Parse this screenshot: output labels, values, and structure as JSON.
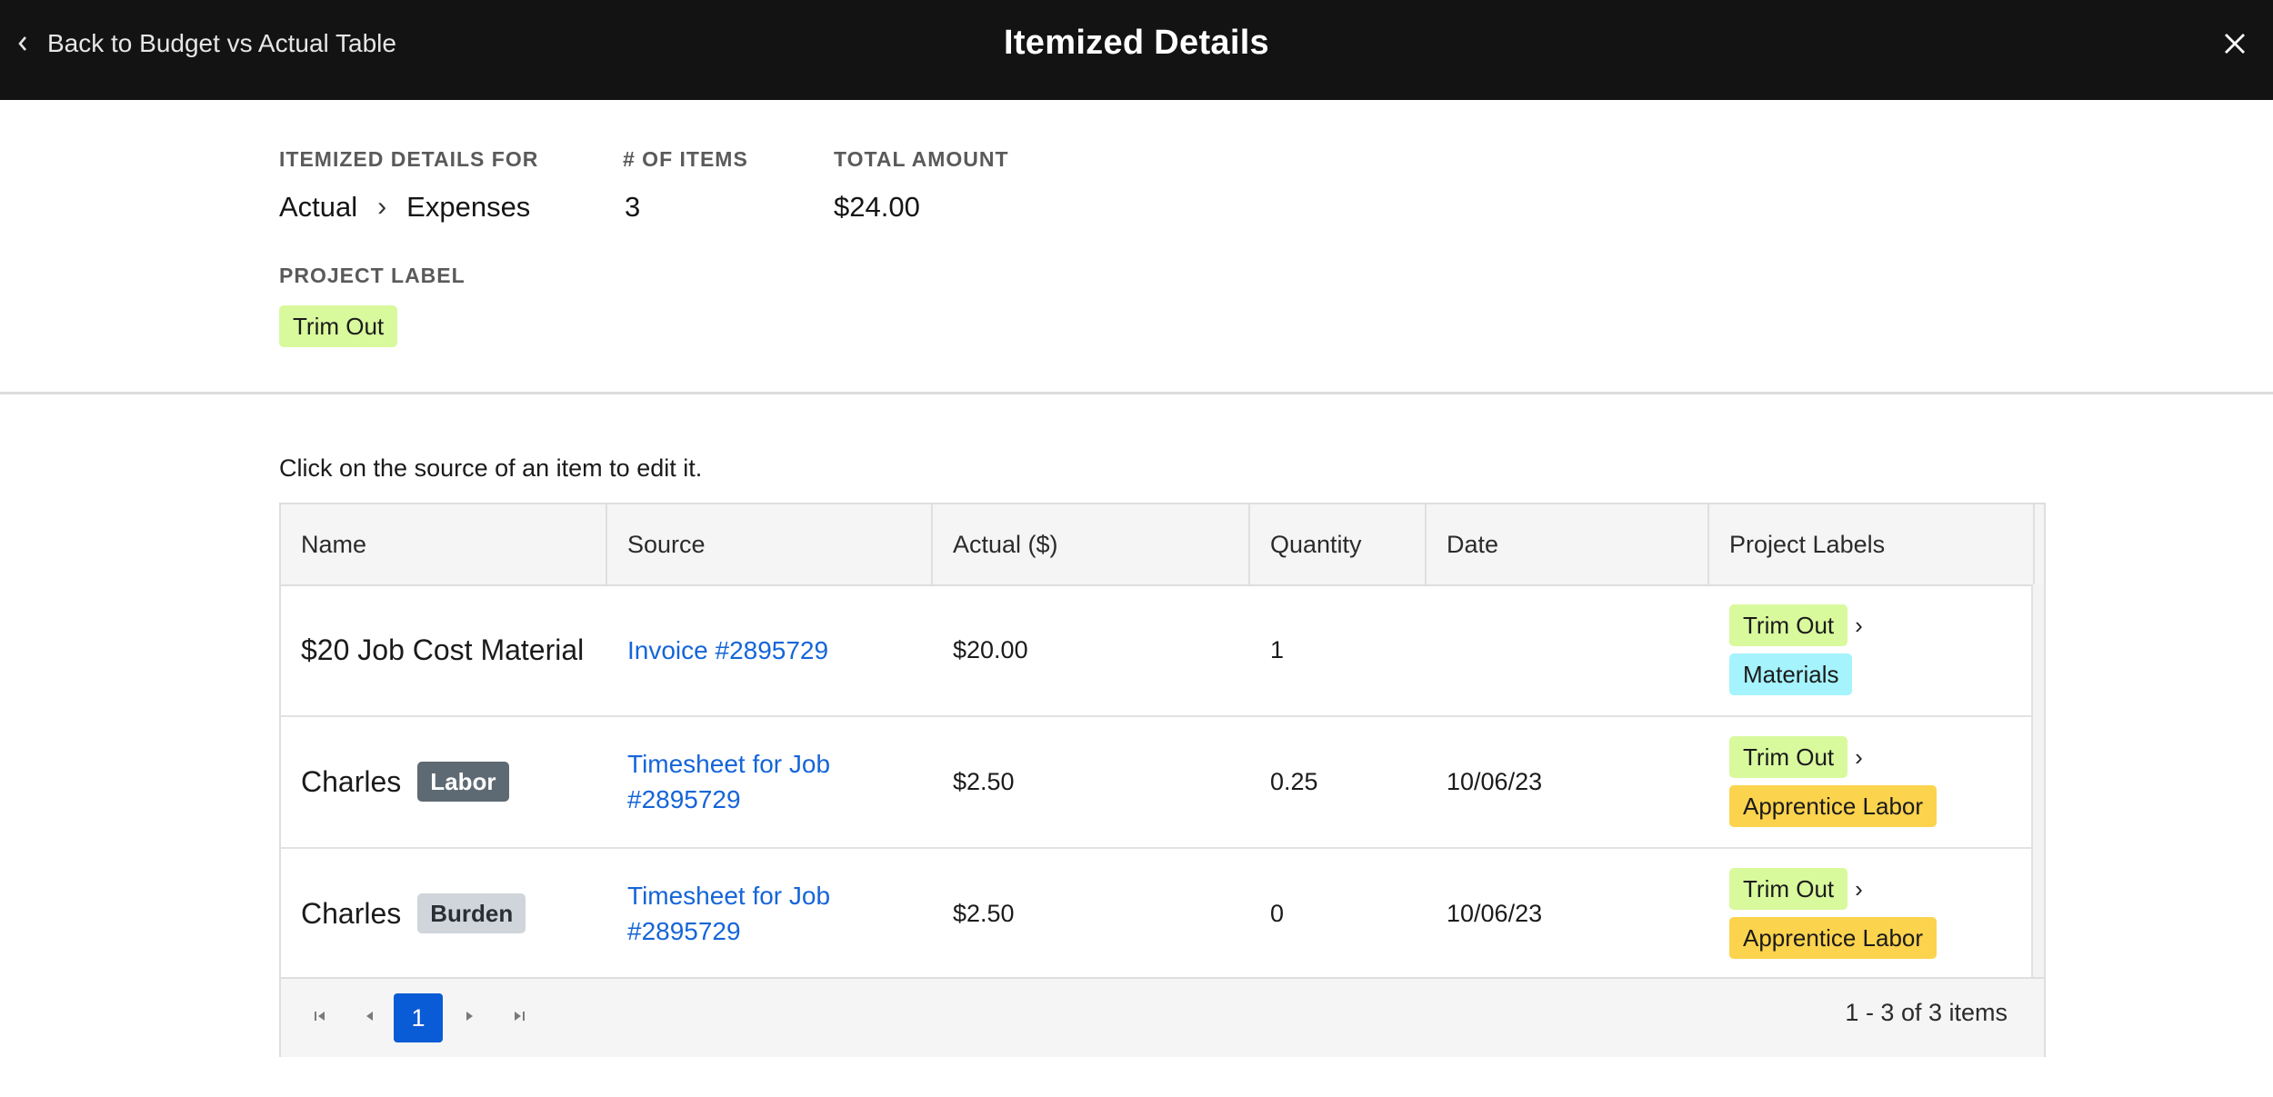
{
  "header": {
    "back_label": "Back to Budget vs Actual Table",
    "title": "Itemized Details"
  },
  "summary": {
    "details_for_label": "ITEMIZED DETAILS FOR",
    "details_for_path": [
      "Actual",
      "Expenses"
    ],
    "items_label": "# OF ITEMS",
    "items_value": "3",
    "total_label": "TOTAL AMOUNT",
    "total_value": "$24.00",
    "project_label_label": "PROJECT LABEL",
    "project_label_value": "Trim Out"
  },
  "hint": "Click on the source of an item to edit it.",
  "table": {
    "columns": [
      "Name",
      "Source",
      "Actual ($)",
      "Quantity",
      "Date",
      "Project Labels"
    ],
    "rows": [
      {
        "name": "$20 Job Cost Material",
        "badge": "",
        "source": [
          "Invoice #2895729"
        ],
        "actual": "$20.00",
        "quantity": "1",
        "date": "",
        "labels": [
          "Trim Out",
          "Materials"
        ]
      },
      {
        "name": "Charles",
        "badge": "Labor",
        "source": [
          "Timesheet for Job",
          "#2895729"
        ],
        "actual": "$2.50",
        "quantity": "0.25",
        "date": "10/06/23",
        "labels": [
          "Trim Out",
          "Apprentice Labor"
        ]
      },
      {
        "name": "Charles",
        "badge": "Burden",
        "source": [
          "Timesheet for Job",
          "#2895729"
        ],
        "actual": "$2.50",
        "quantity": "0",
        "date": "10/06/23",
        "labels": [
          "Trim Out",
          "Apprentice Labor"
        ]
      }
    ]
  },
  "pagination": {
    "current_page": "1",
    "info": "1 - 3 of 3 items"
  },
  "colors": {
    "topbar": "#131313",
    "link": "#1565d8",
    "tag_trim_out": "#d9f99d",
    "tag_materials": "#a5f3fc",
    "tag_apprentice_labor": "#fcd34d",
    "badge_labor": "#5e6a73",
    "badge_burden": "#cfd5da",
    "page_active": "#0a5bd6"
  }
}
